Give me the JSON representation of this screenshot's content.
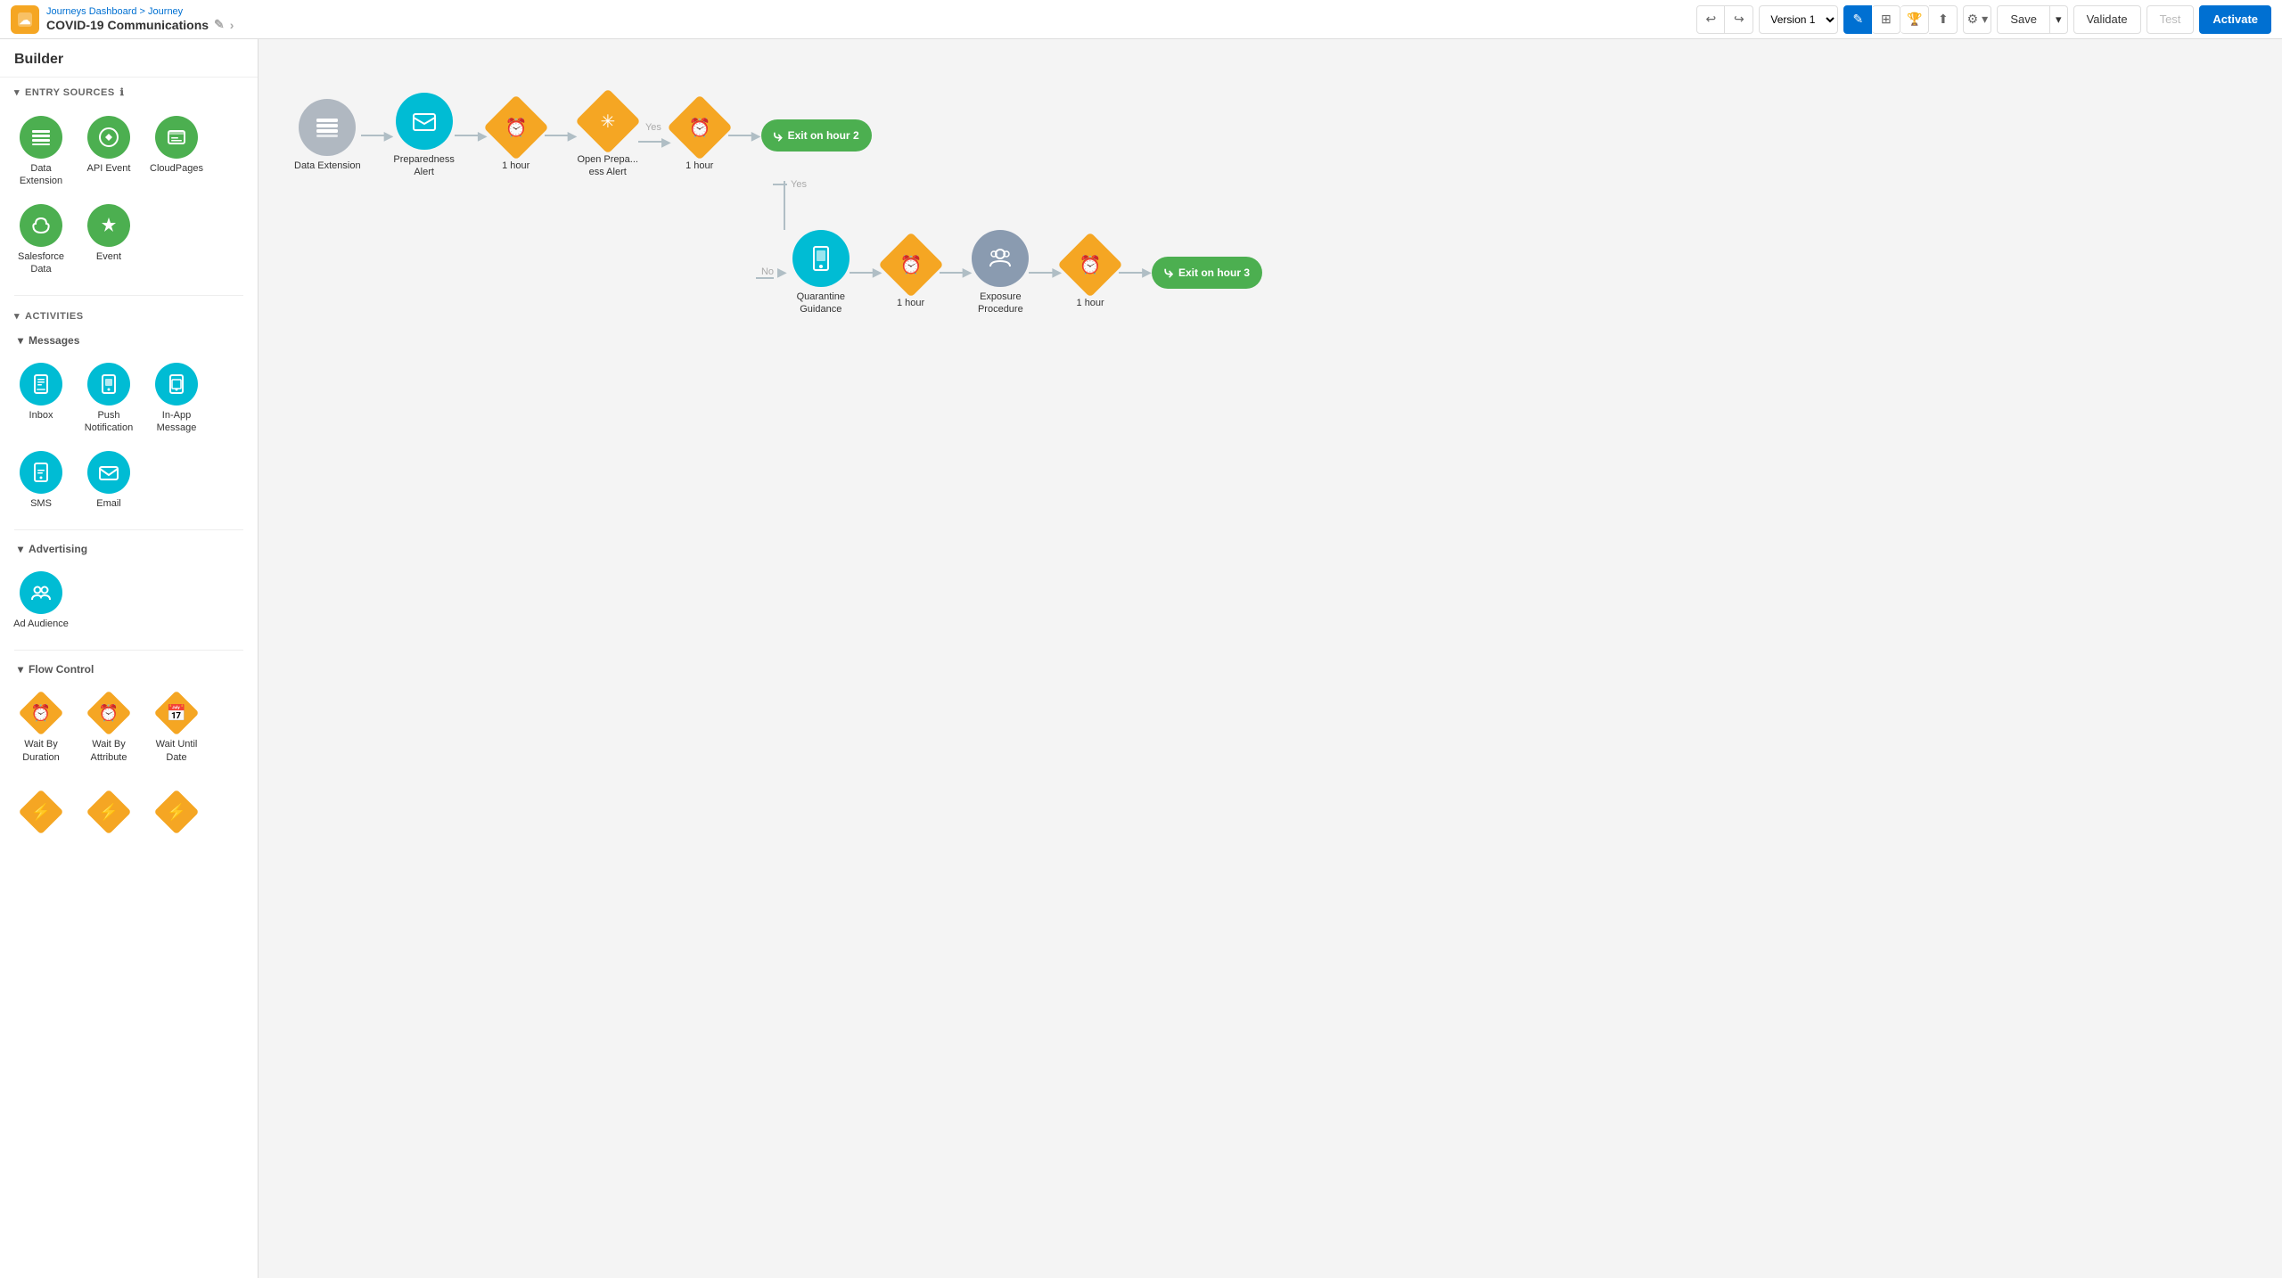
{
  "topbar": {
    "logo_icon": "☁",
    "breadcrumb_top": "Journeys Dashboard > Journey",
    "breadcrumb_title": "COVID-19 Communications",
    "edit_icon": "✎",
    "chevron_icon": ">",
    "version_label": "Version 1",
    "undo_icon": "↩",
    "redo_icon": "↪",
    "pencil_icon": "✎",
    "template_icon": "⊞",
    "trophy_icon": "🏆",
    "export_icon": "⬆",
    "gear_icon": "⚙",
    "save_label": "Save",
    "save_dropdown_icon": "▾",
    "validate_label": "Validate",
    "test_label": "Test",
    "activate_label": "Activate"
  },
  "sidebar": {
    "builder_title": "Builder",
    "entry_sources_label": "ENTRY SOURCES",
    "entry_sources_info": "ℹ",
    "entry_items": [
      {
        "label": "Data Extension",
        "icon": "☰",
        "color": "green"
      },
      {
        "label": "API Event",
        "icon": "⚡",
        "color": "green"
      },
      {
        "label": "CloudPages",
        "icon": "▦",
        "color": "green"
      },
      {
        "label": "Salesforce Data",
        "icon": "☁",
        "color": "green"
      },
      {
        "label": "Event",
        "icon": "⚡",
        "color": "green"
      }
    ],
    "activities_label": "ACTIVITIES",
    "messages_label": "Messages",
    "message_items": [
      {
        "label": "Inbox",
        "icon": "📱",
        "color": "teal"
      },
      {
        "label": "Push Notification",
        "icon": "📱",
        "color": "teal"
      },
      {
        "label": "In-App Message",
        "icon": "📱",
        "color": "teal"
      },
      {
        "label": "SMS",
        "icon": "📱",
        "color": "teal"
      },
      {
        "label": "Email",
        "icon": "✉",
        "color": "teal"
      }
    ],
    "advertising_label": "Advertising",
    "advertising_items": [
      {
        "label": "Ad Audience",
        "icon": "👥",
        "color": "teal"
      }
    ],
    "flow_control_label": "Flow Control",
    "flow_items": [
      {
        "label": "Wait By Duration",
        "icon": "⏰",
        "type": "diamond"
      },
      {
        "label": "Wait By Attribute",
        "icon": "⏰",
        "type": "diamond"
      },
      {
        "label": "Wait Until Date",
        "icon": "⏰",
        "type": "diamond"
      }
    ]
  },
  "canvas": {
    "nodes": {
      "data_extension": {
        "label": "Data Extension",
        "icon": "☰"
      },
      "preparedness_alert": {
        "label": "Preparedness Alert",
        "icon": "✉"
      },
      "wait_1_hour": {
        "label": "1 hour"
      },
      "open_prep_alert": {
        "label": "Open Prepa...\ness Alert",
        "icon": "✳"
      },
      "wait_1_hour_2": {
        "label": "1 hour"
      },
      "exit_hour2": {
        "label": "Exit on hour 2"
      },
      "quarantine": {
        "label": "Quarantine Guidance",
        "icon": "📱"
      },
      "wait_1_hour_3": {
        "label": "1 hour"
      },
      "exposure": {
        "label": "Exposure Procedure",
        "icon": "👥"
      },
      "wait_1_hour_4": {
        "label": "1 hour"
      },
      "exit_hour3": {
        "label": "Exit on hour 3"
      }
    },
    "yes_label": "Yes",
    "no_label": "No"
  }
}
